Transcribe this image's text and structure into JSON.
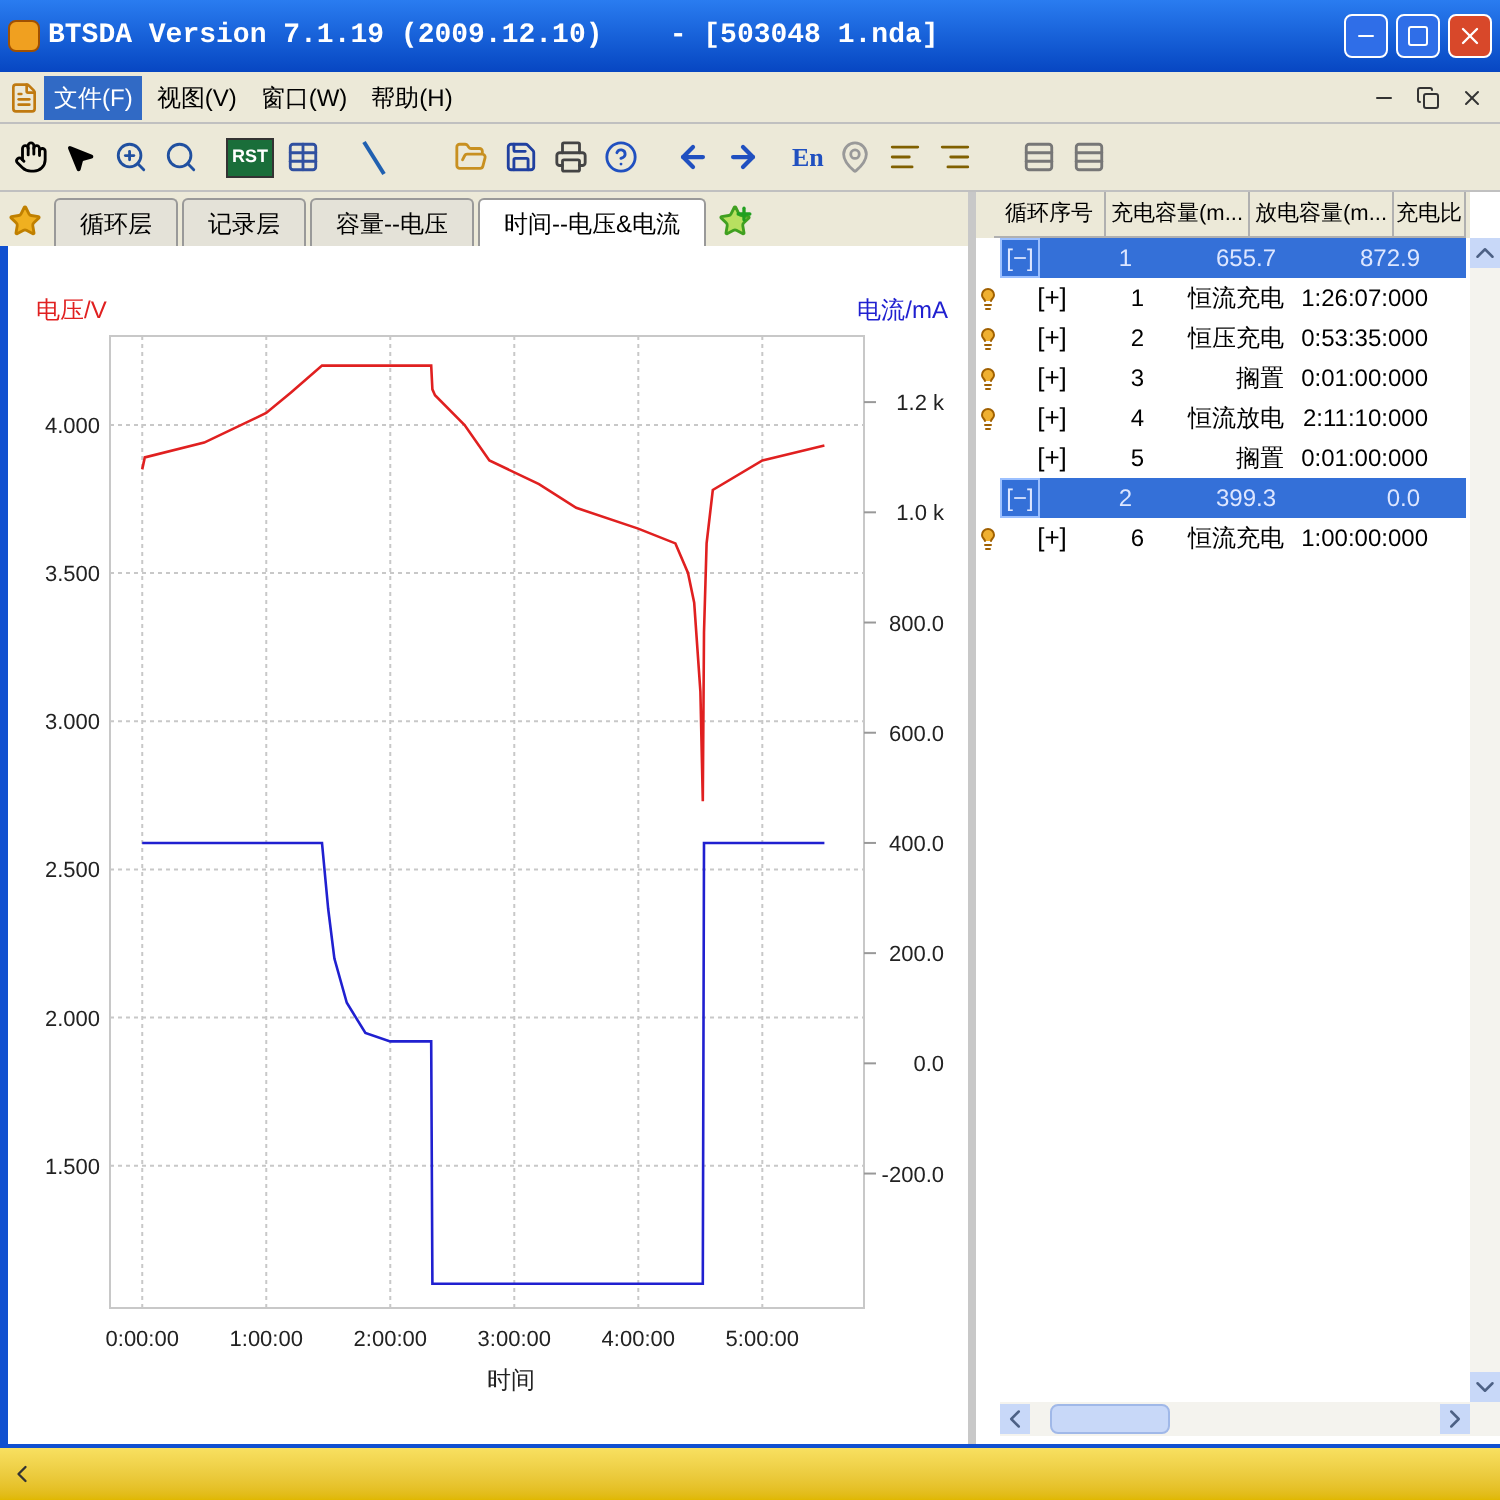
{
  "window": {
    "title": "BTSDA Version 7.1.19 (2009.12.10)    - [503048 1.nda]"
  },
  "menu": [
    {
      "label": "文件(F)",
      "selected": true
    },
    {
      "label": "视图(V)",
      "selected": false
    },
    {
      "label": "窗口(W)",
      "selected": false
    },
    {
      "label": "帮助(H)",
      "selected": false
    }
  ],
  "toolbar": {
    "rst_label": "RST",
    "lang_label": "En"
  },
  "tabs": [
    {
      "label": "循环层",
      "selected": false
    },
    {
      "label": "记录层",
      "selected": false
    },
    {
      "label": "容量--电压",
      "selected": false
    },
    {
      "label": "时间--电压&电流",
      "selected": true
    }
  ],
  "chart": {
    "chart_data": {
      "type": "line",
      "grid": true,
      "xlabel": "时间",
      "ylabel": "电压/V",
      "y2label": "电流/mA",
      "x": [
        0,
        0.02,
        0.5,
        1.0,
        1.2,
        1.45,
        1.5,
        1.55,
        1.65,
        1.8,
        2.0,
        2.33,
        2.34,
        2.36,
        2.6,
        2.8,
        3.2,
        3.5,
        4.0,
        4.3,
        4.4,
        4.45,
        4.5,
        4.52,
        4.53,
        4.55,
        4.6,
        5.0,
        5.5
      ],
      "series": [
        {
          "color": "#e02020",
          "values": [
            3.85,
            3.89,
            3.94,
            4.04,
            4.11,
            4.2,
            4.2,
            4.2,
            4.2,
            4.2,
            4.2,
            4.2,
            4.12,
            4.1,
            4.0,
            3.88,
            3.8,
            3.72,
            3.65,
            3.6,
            3.5,
            3.4,
            3.1,
            2.73,
            3.3,
            3.6,
            3.78,
            3.88,
            3.93
          ]
        },
        {
          "color": "#2020d0",
          "axis": "y2",
          "values": [
            400,
            400,
            400,
            400,
            400,
            400,
            280,
            190,
            110,
            55,
            40,
            40,
            -400,
            -400,
            -400,
            -400,
            -400,
            -400,
            -400,
            -400,
            -400,
            -400,
            -400,
            -400,
            400,
            400,
            400,
            400,
            400
          ]
        }
      ],
      "xlim": [
        -0.26,
        5.82
      ],
      "ylim": [
        1.02,
        4.3
      ],
      "y2lim": [
        -444,
        1320
      ],
      "xticks": [
        {
          "value": 0,
          "label": "0:00:00"
        },
        {
          "value": 1,
          "label": "1:00:00"
        },
        {
          "value": 2,
          "label": "2:00:00"
        },
        {
          "value": 3,
          "label": "3:00:00"
        },
        {
          "value": 4,
          "label": "4:00:00"
        },
        {
          "value": 5,
          "label": "5:00:00"
        }
      ],
      "yticks": [
        {
          "value": 4.0,
          "label": "4.000"
        },
        {
          "value": 3.5,
          "label": "3.500"
        },
        {
          "value": 3.0,
          "label": "3.000"
        },
        {
          "value": 2.5,
          "label": "2.500"
        },
        {
          "value": 2.0,
          "label": "2.000"
        },
        {
          "value": 1.5,
          "label": "1.500"
        }
      ],
      "y2ticks": [
        {
          "value": 1200,
          "label": "1.2 k"
        },
        {
          "value": 1000,
          "label": "1.0 k"
        },
        {
          "value": 800,
          "label": "800.0"
        },
        {
          "value": 600,
          "label": "600.0"
        },
        {
          "value": 400,
          "label": "400.0"
        },
        {
          "value": 200,
          "label": "200.0"
        },
        {
          "value": 0,
          "label": "0.0"
        },
        {
          "value": -200,
          "label": "-200.0"
        }
      ]
    }
  },
  "table": {
    "columns": [
      "循环序号",
      "充电容量(m...",
      "放电容量(m...",
      "充电比"
    ],
    "rows": [
      {
        "kind": "cycle",
        "expander": "[−]",
        "cells": [
          "1",
          "655.7",
          "872.9"
        ]
      },
      {
        "kind": "step",
        "marked": true,
        "expander": "[+]",
        "cells": [
          "1",
          "恒流充电",
          "1:26:07:000"
        ]
      },
      {
        "kind": "step",
        "marked": true,
        "expander": "[+]",
        "cells": [
          "2",
          "恒压充电",
          "0:53:35:000"
        ]
      },
      {
        "kind": "step",
        "marked": true,
        "expander": "[+]",
        "cells": [
          "3",
          "搁置",
          "0:01:00:000"
        ]
      },
      {
        "kind": "step",
        "marked": true,
        "expander": "[+]",
        "cells": [
          "4",
          "恒流放电",
          "2:11:10:000"
        ]
      },
      {
        "kind": "step",
        "marked": false,
        "expander": "[+]",
        "cells": [
          "5",
          "搁置",
          "0:01:00:000"
        ]
      },
      {
        "kind": "cycle",
        "expander": "[−]",
        "cells": [
          "2",
          "399.3",
          "0.0"
        ]
      },
      {
        "kind": "step",
        "marked": true,
        "expander": "[+]",
        "cells": [
          "6",
          "恒流充电",
          "1:00:00:000"
        ]
      }
    ]
  }
}
